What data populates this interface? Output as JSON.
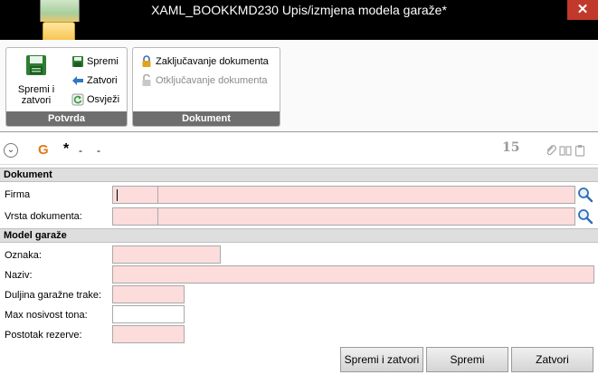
{
  "window": {
    "title": "XAML_BOOKKMD230  Upis/izmjena modela garaže*",
    "close_glyph": "✕"
  },
  "ribbon": {
    "groups": [
      {
        "label": "Potvrda",
        "big_button": {
          "label": "Spremi i zatvori",
          "icon": "save-close-icon"
        },
        "items": [
          {
            "label": "Spremi",
            "icon": "save-icon"
          },
          {
            "label": "Zatvori",
            "icon": "arrow-left-icon"
          },
          {
            "label": "Osvježi",
            "icon": "refresh-icon"
          }
        ]
      },
      {
        "label": "Dokument",
        "items": [
          {
            "label": "Zaključavanje dokumenta",
            "icon": "lock-icon",
            "enabled": true
          },
          {
            "label": "Otključavanje dokumenta",
            "icon": "unlock-icon",
            "enabled": false
          }
        ]
      }
    ]
  },
  "toolbar": {
    "collapse_glyph": "⌄",
    "g_glyph": "G",
    "star": "*",
    "dash1": "-",
    "dash2": "-",
    "count": "15"
  },
  "sections": {
    "dokument": {
      "title": "Dokument",
      "firma_label": "Firma",
      "vrsta_label": "Vrsta dokumenta:"
    },
    "model": {
      "title": "Model garaže",
      "oznaka_label": "Oznaka:",
      "naziv_label": "Naziv:",
      "duljina_label": "Duljina garažne trake:",
      "nosivost_label": "Max nosivost tona:",
      "rezerva_label": "Postotak rezerve:"
    }
  },
  "buttons": {
    "save_close": "Spremi i zatvori",
    "save": "Spremi",
    "close": "Zatvori"
  },
  "colors": {
    "required_field": "#fddcdc",
    "group_label_bg": "#6e6e6e",
    "section_bg": "#dedede"
  }
}
